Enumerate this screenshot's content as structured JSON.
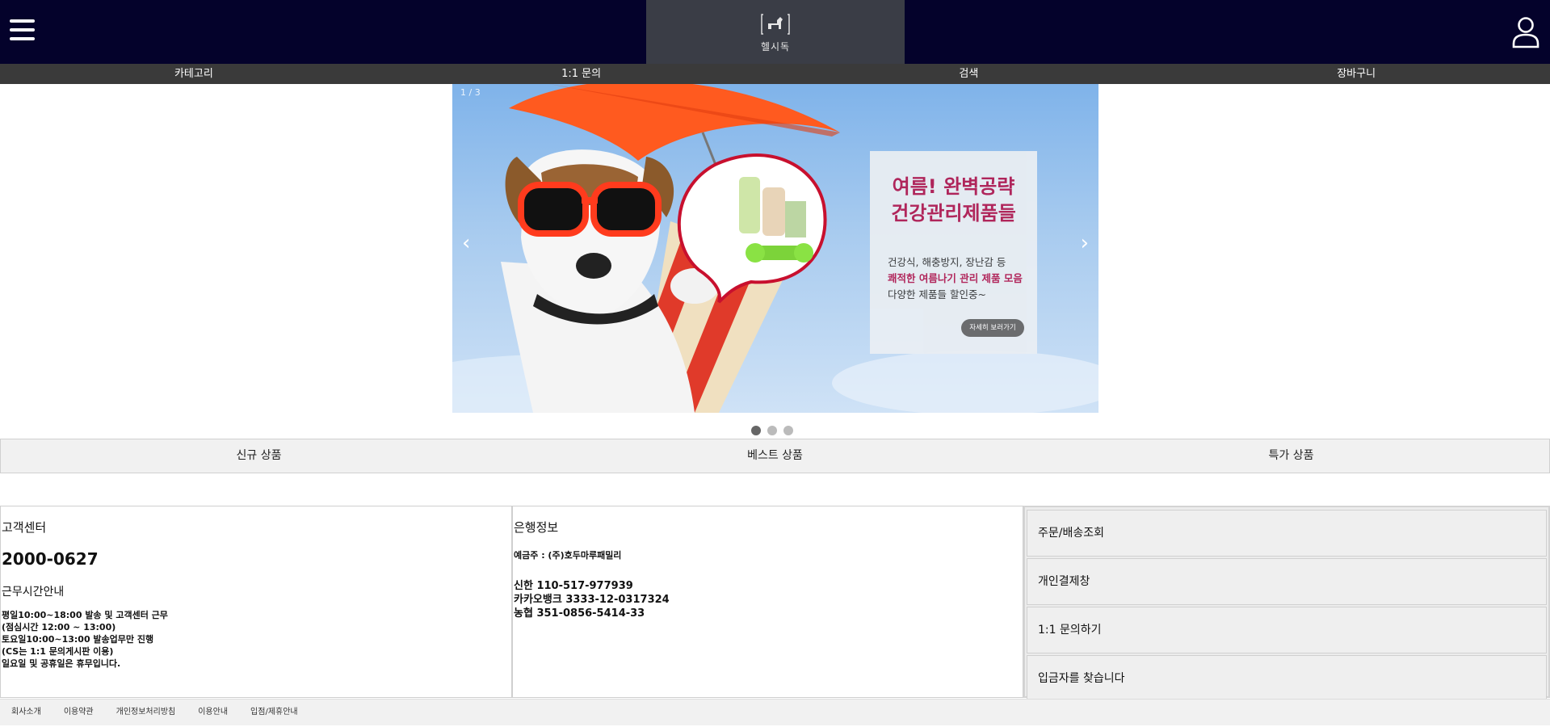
{
  "header": {
    "logo_text": "헬시독",
    "menu_icon": "hamburger-menu-icon",
    "user_icon": "user-icon",
    "bg_color": "#04022b"
  },
  "nav": {
    "items": [
      "카테고리",
      "1:1 문의",
      "검색",
      "장바구니"
    ]
  },
  "banner": {
    "counter": "1 / 3",
    "prev_label": "‹",
    "next_label": "›",
    "headline_1": "여름! 완벽공략",
    "headline_2": "건강관리제품들",
    "body_1": "건강식, 해충방지, 장난감 등",
    "body_2": "쾌적한 여름나기 관리 제품 모음",
    "body_3": "다양한 제품들 할인중~",
    "cta": "자세히 보러가기",
    "accent_color": "#b11c52",
    "slides_total": 3,
    "active_slide": 1
  },
  "tabs": [
    "신규 상품",
    "베스트 상품",
    "특가 상품"
  ],
  "customer_center": {
    "title": "고객센터",
    "phone": "2000-0627",
    "hours_title": "근무시간안내",
    "hours": [
      "평일10:00~18:00 발송 및 고객센터 근무",
      "(점심시간 12:00 ~ 13:00)",
      "토요일10:00~13:00 발송업무만 진행",
      "(CS는 1:1 문의게시판 이용)",
      "일요일 및 공휴일은 휴무입니다."
    ]
  },
  "bank_info": {
    "title": "은행정보",
    "holder": "예금주 : (주)호두마루패밀리",
    "accounts": [
      "신한 110-517-977939",
      "카카오뱅크 3333-12-0317324",
      "농협 351-0856-5414-33"
    ]
  },
  "quick_links": [
    "주문/배송조회",
    "개인결제창",
    "1:1 문의하기",
    "입금자를 찾습니다"
  ],
  "footer": {
    "links": [
      "회사소개",
      "이용약관",
      "개인정보처리방침",
      "이용안내",
      "입점/제휴안내"
    ]
  }
}
